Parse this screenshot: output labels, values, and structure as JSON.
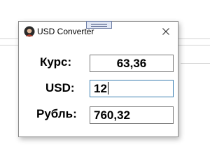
{
  "window": {
    "title": "USD Converter",
    "app_icon": "avatar-icon",
    "close_icon": "close-icon"
  },
  "form": {
    "rate_label": "Курс:",
    "rate_value": "63,36",
    "usd_label": "USD:",
    "usd_value": "12",
    "rub_label": "Рубль:",
    "rub_value": "760,32"
  },
  "colors": {
    "focus_border": "#3c7fb1",
    "field_border": "#7a7a7a"
  }
}
